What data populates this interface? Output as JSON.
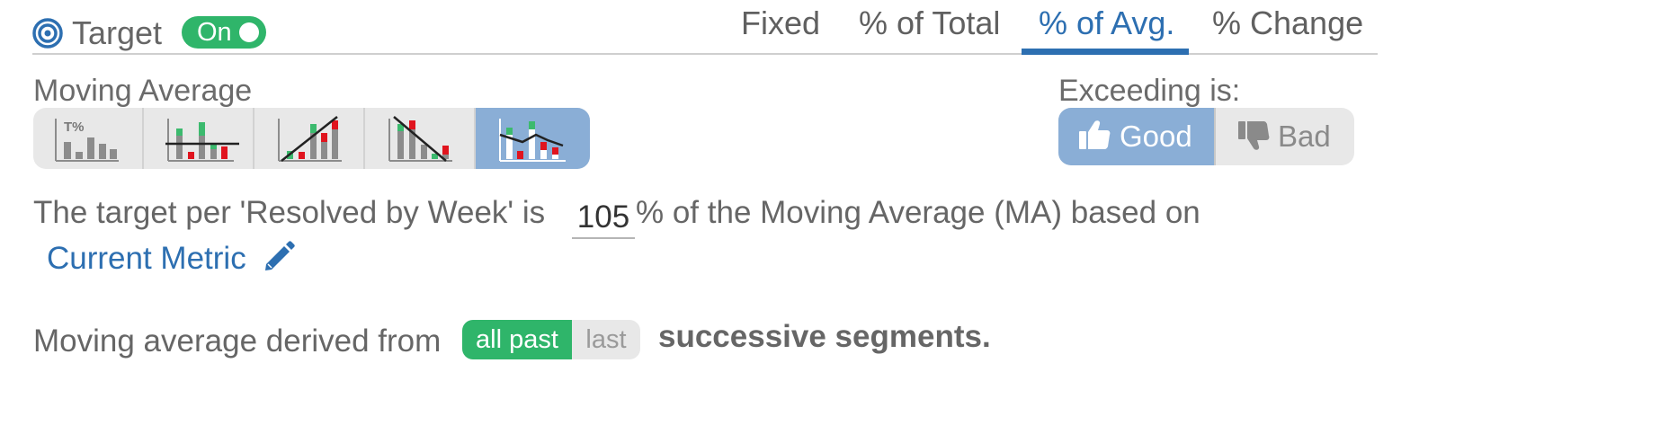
{
  "header": {
    "target_label": "Target",
    "toggle_label": "On",
    "tabs": [
      {
        "label": "Fixed",
        "active": false
      },
      {
        "label": "% of Total",
        "active": false
      },
      {
        "label": "% of Avg.",
        "active": true
      },
      {
        "label": "% Change",
        "active": false
      }
    ]
  },
  "moving_average": {
    "title": "Moving Average",
    "options": [
      {
        "icon": "percent-of-total-chart-icon",
        "active": false,
        "icon_text": "T%"
      },
      {
        "icon": "fixed-line-chart-icon",
        "active": false
      },
      {
        "icon": "rising-trend-chart-icon",
        "active": false
      },
      {
        "icon": "falling-trend-chart-icon",
        "active": false
      },
      {
        "icon": "moving-average-chart-icon",
        "active": true
      }
    ]
  },
  "exceeding": {
    "label": "Exceeding is:",
    "good_label": "Good",
    "bad_label": "Bad",
    "selected": "Good"
  },
  "sentence": {
    "prefix": "The target per 'Resolved by Week' is",
    "percent_value": "105",
    "suffix": "% of the Moving Average (MA) based on",
    "metric_link": "Current Metric"
  },
  "derivation": {
    "prefix": "Moving average derived from",
    "options": [
      "all past",
      "last"
    ],
    "selected": "all past",
    "suffix": "successive segments."
  },
  "colors": {
    "accent_blue": "#2d6fb1",
    "toggle_green": "#2fb56a",
    "selected_bg": "#8aaed6",
    "bar_green": "#3cba6e",
    "bar_red": "#e0141e",
    "bar_gray": "#8c8c8c"
  }
}
